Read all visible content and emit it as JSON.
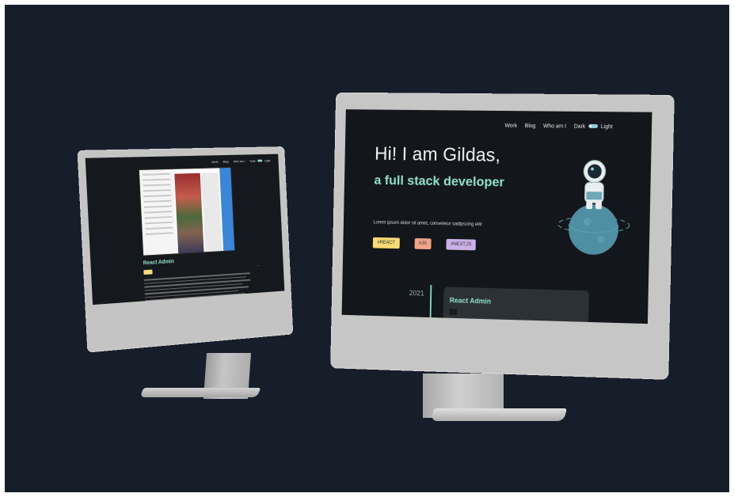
{
  "left_screen": {
    "nav": {
      "work": "Work",
      "blog": "Blog",
      "who": "Who am I",
      "dark": "Dark",
      "light": "Light"
    },
    "project_title": "React Admin"
  },
  "right_screen": {
    "nav": {
      "work": "Work",
      "blog": "Blog",
      "who": "Who am I",
      "dark": "Dark",
      "light": "Light"
    },
    "hero": {
      "greeting": "Hi! I am Gildas,",
      "subtitle": "a full stack developer",
      "lorem": "Lorem ipsum dolor sit amet, consetetur sadipscing elitr"
    },
    "tags": [
      "#REACT",
      "#JS",
      "#NEXT.JS"
    ],
    "timeline": {
      "year": "2021",
      "card_title": "React Admin"
    }
  },
  "colors": {
    "background": "#161e29",
    "accent_green": "#8fe3c8",
    "tag_react": "#f6db73",
    "tag_js": "#f2a286",
    "tag_next": "#c9b1e7",
    "toggle": "#8ecfd6"
  },
  "icons": [
    "astronaut-illustration",
    "theme-toggle-icon"
  ]
}
